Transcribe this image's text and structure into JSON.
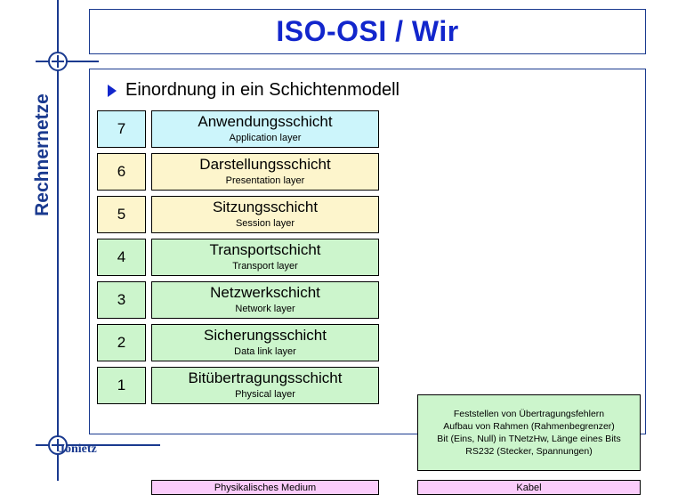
{
  "slide": {
    "title": "ISO-OSI / Wir",
    "sidebar_label": "Rechnernetze",
    "author": "Jonietz",
    "heading": "Einordnung in ein Schichtenmodell"
  },
  "colors": {
    "accent_blue": "#1a3a8f",
    "title_blue": "#1226cc",
    "layer_cyan": "#ccf5fb",
    "layer_yellow": "#fdf5cc",
    "layer_green": "#ccf5cc",
    "medium_pink": "#fbccfb"
  },
  "layers": [
    {
      "number": "7",
      "name_de": "Anwendungsschicht",
      "name_en": "Application layer",
      "color": "#ccf5fb"
    },
    {
      "number": "6",
      "name_de": "Darstellungsschicht",
      "name_en": "Presentation layer",
      "color": "#fdf5cc"
    },
    {
      "number": "5",
      "name_de": "Sitzungsschicht",
      "name_en": "Session layer",
      "color": "#fdf5cc"
    },
    {
      "number": "4",
      "name_de": "Transportschicht",
      "name_en": "Transport layer",
      "color": "#ccf5cc"
    },
    {
      "number": "3",
      "name_de": "Netzwerkschicht",
      "name_en": "Network layer",
      "color": "#ccf5cc"
    },
    {
      "number": "2",
      "name_de": "Sicherungsschicht",
      "name_en": "Data link layer",
      "color": "#ccf5cc"
    },
    {
      "number": "1",
      "name_de": "Bitübertragungsschicht",
      "name_en": "Physical layer",
      "color": "#ccf5cc"
    }
  ],
  "medium": {
    "label": "Physikalisches Medium",
    "cable_label": "Kabel"
  },
  "note": {
    "lines": [
      "Feststellen von Übertragungsfehlern",
      "Aufbau von Rahmen (Rahmenbegrenzer)",
      "Bit (Eins, Null) in TNetzHw, Länge eines Bits",
      "RS232 (Stecker, Spannungen)"
    ]
  }
}
